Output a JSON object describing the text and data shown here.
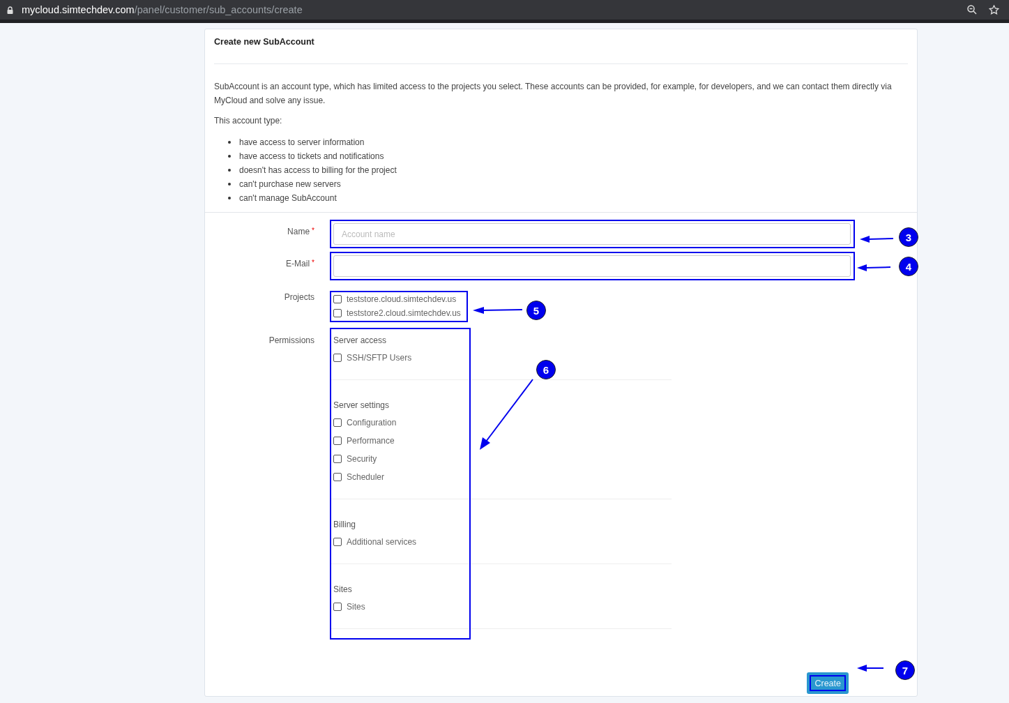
{
  "browser": {
    "url_host": "mycloud.simtechdev.com",
    "url_path": "/panel/customer/sub_accounts/create"
  },
  "card": {
    "title": "Create new SubAccount",
    "description": "SubAccount is an account type, which has limited access to the projects you select. These accounts can be provided, for example, for developers, and we can contact them directly via MyCloud and solve any issue.",
    "list_intro": "This account type:",
    "features": [
      "have access to server information",
      "have access to tickets and notifications",
      "doesn't has access to billing for the project",
      "can't purchase new servers",
      "can't manage SubAccount"
    ]
  },
  "form": {
    "name": {
      "label": "Name",
      "required_mark": "*",
      "placeholder": "Account name"
    },
    "email": {
      "label": "E-Mail",
      "required_mark": "*"
    },
    "projects": {
      "label": "Projects",
      "options": [
        {
          "label": "teststore.cloud.simtechdev.us",
          "checked": false
        },
        {
          "label": "teststore2.cloud.simtechdev.us",
          "checked": false
        }
      ]
    },
    "permissions": {
      "label": "Permissions",
      "sections": [
        {
          "title": "Server access",
          "options": [
            {
              "label": "SSH/SFTP Users",
              "checked": false
            }
          ]
        },
        {
          "title": "Server settings",
          "options": [
            {
              "label": "Configuration",
              "checked": false
            },
            {
              "label": "Performance",
              "checked": false
            },
            {
              "label": "Security",
              "checked": false
            },
            {
              "label": "Scheduler",
              "checked": false
            }
          ]
        },
        {
          "title": "Billing",
          "options": [
            {
              "label": "Additional services",
              "checked": false
            }
          ]
        },
        {
          "title": "Sites",
          "options": [
            {
              "label": "Sites",
              "checked": false
            }
          ]
        }
      ]
    },
    "submit": "Create"
  },
  "annotations": [
    {
      "number": "3"
    },
    {
      "number": "4"
    },
    {
      "number": "5"
    },
    {
      "number": "6"
    },
    {
      "number": "7"
    }
  ]
}
